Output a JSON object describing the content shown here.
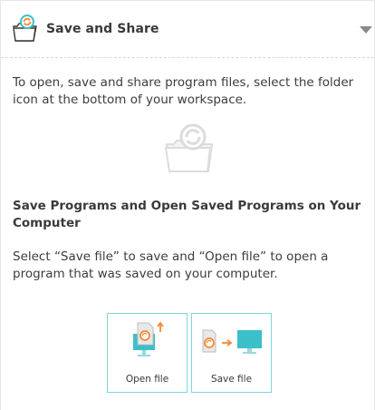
{
  "header": {
    "title": "Save and Share",
    "icon": "folder-share-icon",
    "toggle_icon": "chevron-down-icon"
  },
  "intro": {
    "text": "To open, save and share program files, select the folder icon at the bottom of your workspace."
  },
  "illustration": {
    "icon": "folder-share-icon"
  },
  "section": {
    "heading": "Save Programs and Open Saved Programs on Your Computer",
    "text": "Select “Save file” to save and “Open file” to open a program that was saved on your computer."
  },
  "buttons": {
    "open_label": "Open file",
    "save_label": "Save file"
  },
  "colors": {
    "accent_orange": "#f28a30",
    "accent_teal": "#3bbfc9",
    "button_border": "#7dd6dc",
    "text": "#3c3c3c"
  }
}
